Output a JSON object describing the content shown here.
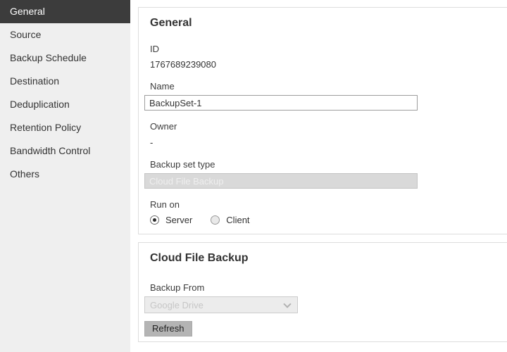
{
  "sidebar": {
    "items": [
      {
        "label": "General",
        "selected": true
      },
      {
        "label": "Source",
        "selected": false
      },
      {
        "label": "Backup Schedule",
        "selected": false
      },
      {
        "label": "Destination",
        "selected": false
      },
      {
        "label": "Deduplication",
        "selected": false
      },
      {
        "label": "Retention Policy",
        "selected": false
      },
      {
        "label": "Bandwidth Control",
        "selected": false
      },
      {
        "label": "Others",
        "selected": false
      }
    ]
  },
  "general_panel": {
    "title": "General",
    "id": {
      "label": "ID",
      "value": "1767689239080"
    },
    "name": {
      "label": "Name",
      "value": "BackupSet-1"
    },
    "owner": {
      "label": "Owner",
      "value": "-"
    },
    "type": {
      "label": "Backup set type",
      "value": "Cloud File Backup",
      "disabled": true
    },
    "run_on": {
      "label": "Run on",
      "options": [
        {
          "label": "Server",
          "selected": true
        },
        {
          "label": "Client",
          "selected": false
        }
      ]
    }
  },
  "cloud_panel": {
    "title": "Cloud File Backup",
    "backup_from": {
      "label": "Backup From",
      "value": "Google Drive",
      "disabled": true
    },
    "refresh_label": "Refresh"
  },
  "colors": {
    "sidebar_bg": "#efefef",
    "sidebar_selected_bg": "#3c3c3c",
    "sidebar_selected_text": "#ffffff",
    "panel_border": "#dddddd",
    "disabled_field_bg": "#d9d9d9",
    "disabled_field_text": "#efefef",
    "button_bg": "#b4b4b4",
    "text": "#333333"
  }
}
